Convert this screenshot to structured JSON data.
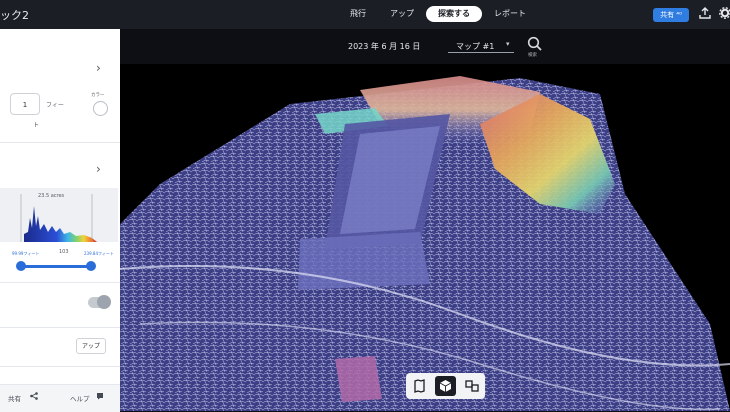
{
  "header": {
    "app_title": "ック2",
    "nav": [
      {
        "label": "飛行"
      },
      {
        "label": "アップ"
      },
      {
        "label": "探索する"
      },
      {
        "label": "レポート"
      }
    ],
    "share_label": "共有 ⁴⁰",
    "accent_color": "#2f7de1"
  },
  "toolbar": {
    "date": "2023 年 6 月 16 日",
    "map_selected": "マップ #1",
    "search_label": "検索"
  },
  "sidebar": {
    "elevation_value": "1",
    "elevation_unit": "フィー",
    "elevation_sub": "ト",
    "color_label": "カラー",
    "histogram_area": "23.5 acres",
    "range_min": "99.99フィート",
    "range_mid": "103",
    "range_max": "239.84フィート",
    "apply_button": "アップ",
    "footer_share": "共有",
    "footer_help": "ヘルプ"
  },
  "bottom_toolbar": {
    "icons": [
      "map-view-icon",
      "3d-model-icon",
      "split-view-icon"
    ],
    "active_icon": "3d-model-icon"
  }
}
